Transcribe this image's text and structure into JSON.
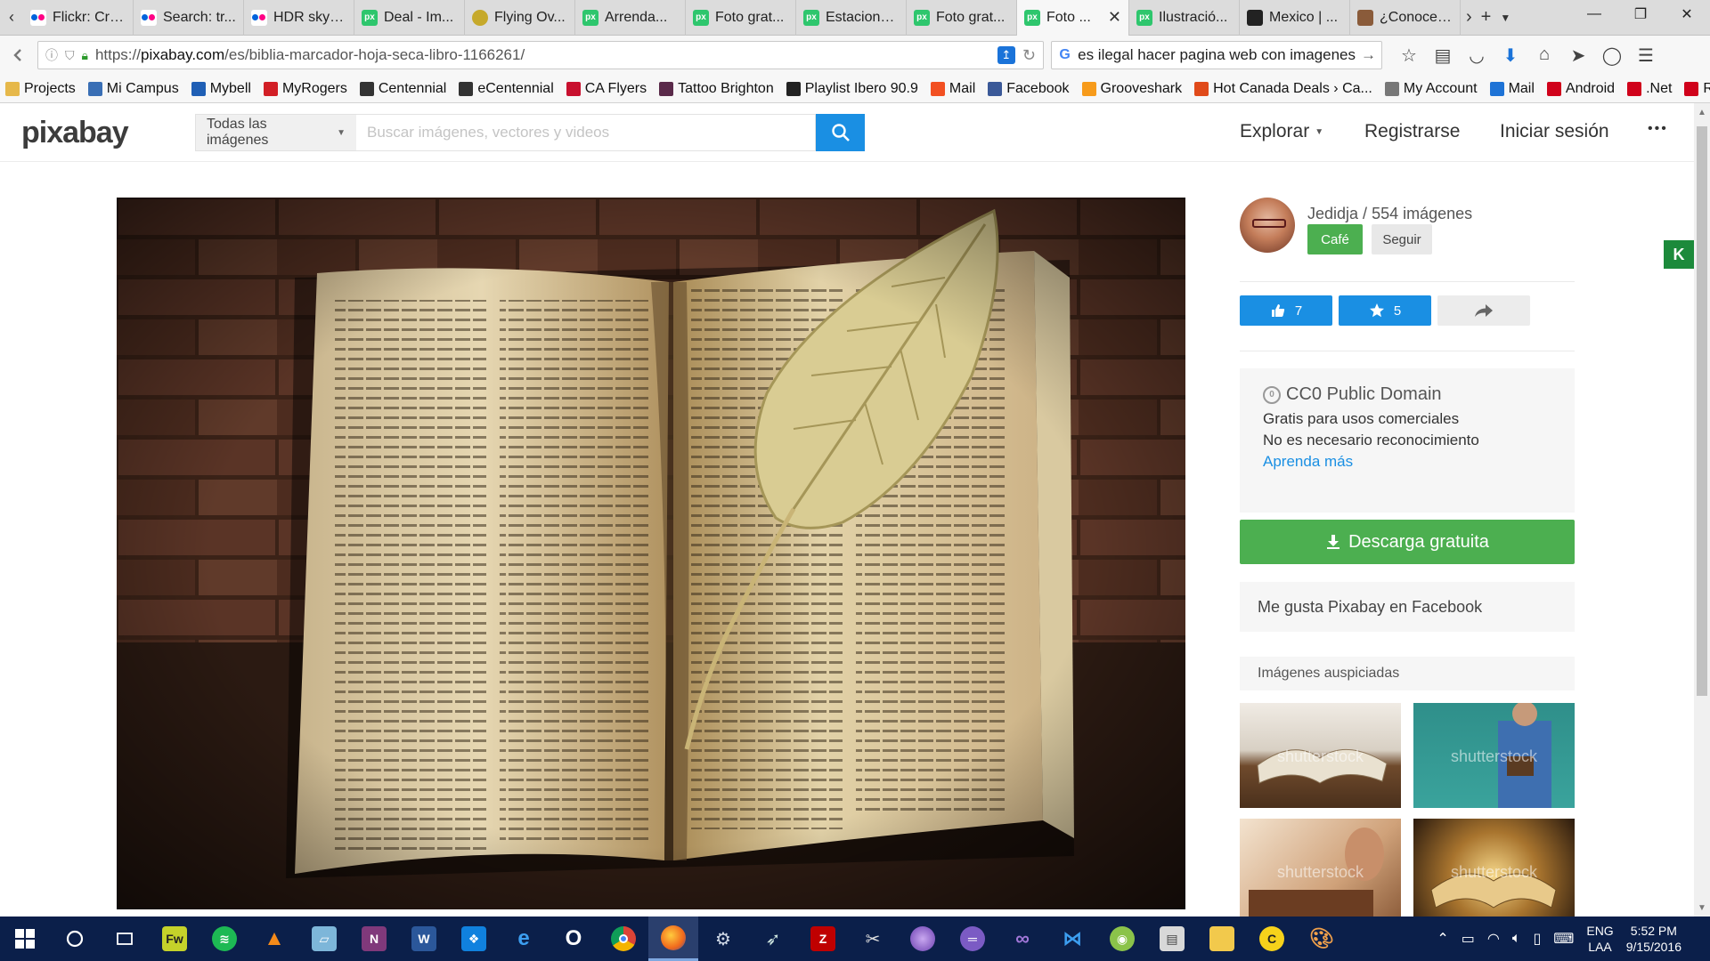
{
  "browser": {
    "tabs": [
      {
        "title": "Flickr: Cre...",
        "fav": "flickr"
      },
      {
        "title": "Search: tr...",
        "fav": "flickr"
      },
      {
        "title": "HDR skyli...",
        "fav": "flickr"
      },
      {
        "title": "Deal - Im...",
        "fav": "px"
      },
      {
        "title": "Flying Ov...",
        "fav": "bee"
      },
      {
        "title": "Arrenda...",
        "fav": "px"
      },
      {
        "title": "Foto grat...",
        "fav": "px"
      },
      {
        "title": "Estaciona...",
        "fav": "px"
      },
      {
        "title": "Foto grat...",
        "fav": "px"
      },
      {
        "title": "Foto ...",
        "fav": "px",
        "active": true
      },
      {
        "title": "Ilustració...",
        "fav": "px"
      },
      {
        "title": "Mexico | ...",
        "fav": "cam"
      },
      {
        "title": "¿Conoces...",
        "fav": "face"
      }
    ],
    "url": {
      "prefix": "https://",
      "domain": "pixabay.com",
      "path": "/es/biblia-marcador-hoja-seca-libro-1166261/"
    },
    "search_value": "es ilegal hacer pagina web con imagenes",
    "bookmarks": [
      {
        "label": "Projects",
        "color": "#e6b84a"
      },
      {
        "label": "Mi Campus",
        "color": "#3a6fb5"
      },
      {
        "label": "Mybell",
        "color": "#1f5fb5"
      },
      {
        "label": "MyRogers",
        "color": "#d21f26"
      },
      {
        "label": "Centennial",
        "color": "#333333"
      },
      {
        "label": "eCentennial",
        "color": "#333333"
      },
      {
        "label": "CA Flyers",
        "color": "#c8102e"
      },
      {
        "label": "Tattoo Brighton",
        "color": "#5a2a4a"
      },
      {
        "label": "Playlist Ibero 90.9",
        "color": "#222222"
      },
      {
        "label": "Mail",
        "color": "#f25022"
      },
      {
        "label": "Facebook",
        "color": "#3b5998"
      },
      {
        "label": "Grooveshark",
        "color": "#f79b1b"
      },
      {
        "label": "Hot Canada Deals › Ca...",
        "color": "#e04a1a"
      },
      {
        "label": "My Account",
        "color": "#777777"
      },
      {
        "label": "Mail",
        "color": "#1e73d6"
      },
      {
        "label": "Android",
        "color": "#d0021b"
      },
      {
        "label": ".Net",
        "color": "#d0021b"
      },
      {
        "label": "RedFlagDeals",
        "color": "#d0021b"
      }
    ]
  },
  "pixabay": {
    "logo": "pixabay",
    "search_category": "Todas las imágenes",
    "search_placeholder": "Buscar imágenes, vectores y videos",
    "nav": {
      "explore": "Explorar",
      "register": "Registrarse",
      "login": "Iniciar sesión",
      "more": "•••"
    },
    "author": {
      "name": "Jedidja",
      "images": "554 imágenes",
      "cafe": "Café",
      "follow": "Seguir"
    },
    "stats": {
      "likes": "7",
      "favorites": "5"
    },
    "license": {
      "title": "CC0 Public Domain",
      "line1": "Gratis para usos comerciales",
      "line2": "No es necesario reconocimiento",
      "learn": "Aprenda más"
    },
    "download": "Descarga gratuita",
    "facebook": "Me gusta Pixabay en Facebook",
    "sponsored": "Imágenes auspiciadas",
    "watermark": "shutterstock",
    "k_badge": "K"
  },
  "taskbar": {
    "lang1": "ENG",
    "lang2": "LAA",
    "time": "5:52 PM",
    "date": "9/15/2016"
  }
}
